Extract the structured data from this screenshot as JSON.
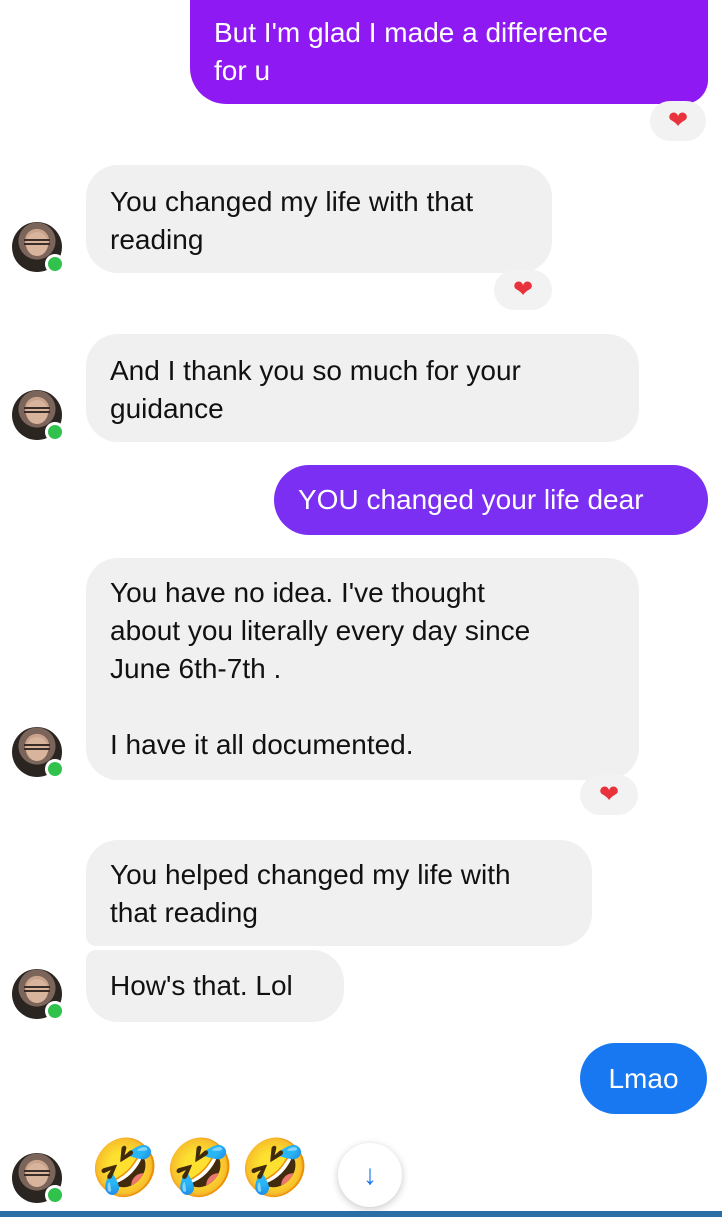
{
  "colors": {
    "outgoing_purple": "#8f19f2",
    "outgoing_violet": "#7b2ff2",
    "outgoing_blue": "#1778f2",
    "incoming_gray": "#f0f0f0",
    "reaction_heart": "#e8323c",
    "online_green": "#31c24d"
  },
  "messages": [
    {
      "id": "m1",
      "sender": "me",
      "text": "But I'm glad I made a difference\nfor u",
      "reaction": "❤"
    },
    {
      "id": "m2",
      "sender": "them",
      "text": "You changed my life with that\nreading",
      "reaction": "❤"
    },
    {
      "id": "m3",
      "sender": "them",
      "text": "And I thank you so much for your\nguidance"
    },
    {
      "id": "m4",
      "sender": "me",
      "text": "YOU changed your life dear"
    },
    {
      "id": "m5",
      "sender": "them",
      "text": "You have no idea. I've thought\nabout you literally every day since\nJune 6th-7th .\n\nI have it all documented.",
      "reaction": "❤"
    },
    {
      "id": "m6",
      "sender": "them",
      "text": "You helped changed my life with\nthat reading"
    },
    {
      "id": "m7",
      "sender": "them",
      "text": "How's that. Lol"
    },
    {
      "id": "m8",
      "sender": "me",
      "text": "Lmao"
    }
  ],
  "emoji_message": [
    "🤣",
    "🤣",
    "🤣"
  ],
  "scroll_button": {
    "icon": "arrow-down-icon",
    "glyph": "↓"
  }
}
